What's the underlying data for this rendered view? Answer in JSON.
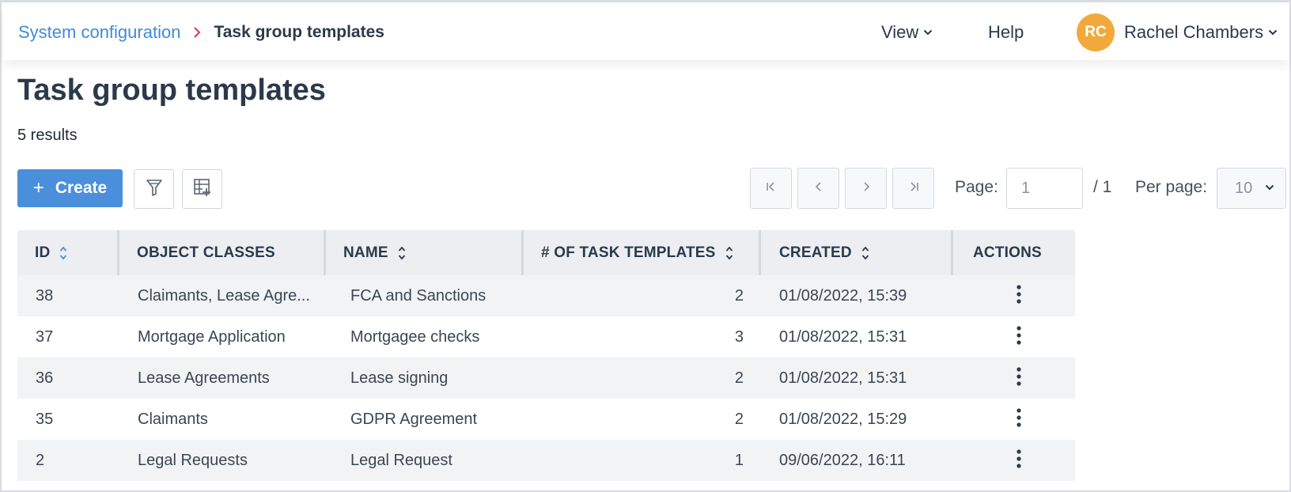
{
  "header": {
    "breadcrumb": {
      "parent": "System configuration",
      "current": "Task group templates"
    },
    "view_label": "View",
    "help_label": "Help",
    "user": {
      "initials": "RC",
      "name": "Rachel Chambers",
      "avatar_color": "#f2a93b"
    }
  },
  "page": {
    "title": "Task group templates",
    "results": "5 results"
  },
  "toolbar": {
    "create_label": "Create",
    "accent_color": "#4a8fdc"
  },
  "pagination": {
    "page_label": "Page:",
    "page_value": "1",
    "total_pages": "/ 1",
    "per_page_label": "Per page:",
    "per_page_value": "10"
  },
  "table": {
    "columns": [
      "ID",
      "OBJECT CLASSES",
      "NAME",
      "# OF TASK TEMPLATES",
      "CREATED",
      "ACTIONS"
    ],
    "rows": [
      {
        "id": "38",
        "object_classes": "Claimants, Lease Agre...",
        "name": "FCA and Sanctions",
        "task_templates": "2",
        "created": "01/08/2022, 15:39"
      },
      {
        "id": "37",
        "object_classes": "Mortgage Application",
        "name": "Mortgagee checks",
        "task_templates": "3",
        "created": "01/08/2022, 15:31"
      },
      {
        "id": "36",
        "object_classes": "Lease Agreements",
        "name": "Lease signing",
        "task_templates": "2",
        "created": "01/08/2022, 15:31"
      },
      {
        "id": "35",
        "object_classes": "Claimants",
        "name": "GDPR Agreement",
        "task_templates": "2",
        "created": "01/08/2022, 15:29"
      },
      {
        "id": "2",
        "object_classes": "Legal Requests",
        "name": "Legal Request",
        "task_templates": "1",
        "created": "09/06/2022, 16:11"
      }
    ]
  }
}
